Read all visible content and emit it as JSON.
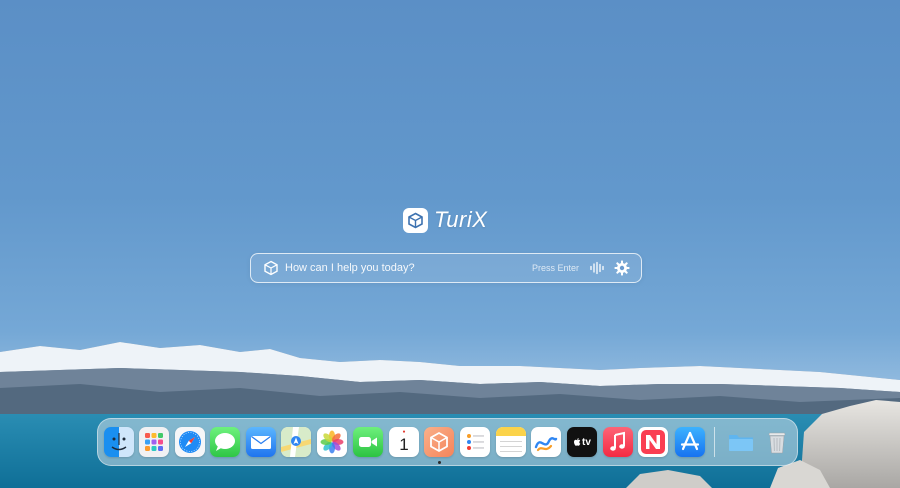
{
  "brand": {
    "name": "TuriX",
    "logo_icon": "turix-cube-icon"
  },
  "search": {
    "placeholder": "How can I help you today?",
    "value": "",
    "hint": "Press Enter",
    "voice_icon": "waveform-icon",
    "settings_icon": "gear-icon"
  },
  "dock": {
    "items": [
      {
        "name": "Finder",
        "icon": "finder-icon"
      },
      {
        "name": "Launchpad",
        "icon": "launchpad-icon"
      },
      {
        "name": "Safari",
        "icon": "safari-icon"
      },
      {
        "name": "Messages",
        "icon": "messages-icon"
      },
      {
        "name": "Mail",
        "icon": "mail-icon"
      },
      {
        "name": "Maps",
        "icon": "maps-icon"
      },
      {
        "name": "Photos",
        "icon": "photos-icon"
      },
      {
        "name": "FaceTime",
        "icon": "facetime-icon"
      },
      {
        "name": "Calendar",
        "icon": "calendar-icon",
        "day": "1"
      },
      {
        "name": "TuriX",
        "icon": "turix-app-icon",
        "running": true
      },
      {
        "name": "Reminders",
        "icon": "reminders-icon"
      },
      {
        "name": "Notes",
        "icon": "notes-icon"
      },
      {
        "name": "Freeform",
        "icon": "freeform-icon"
      },
      {
        "name": "TV",
        "icon": "apple-tv-icon",
        "label": "tv"
      },
      {
        "name": "Music",
        "icon": "music-icon"
      },
      {
        "name": "News",
        "icon": "news-icon"
      },
      {
        "name": "App Store",
        "icon": "app-store-icon"
      },
      {
        "name": "Downloads",
        "icon": "folder-icon"
      },
      {
        "name": "Trash",
        "icon": "trash-icon"
      }
    ]
  },
  "colors": {
    "sky": "#5b8fc6",
    "lake": "#1f7fa6",
    "snow": "#f2f6fb",
    "mountain": "#5a7088"
  }
}
